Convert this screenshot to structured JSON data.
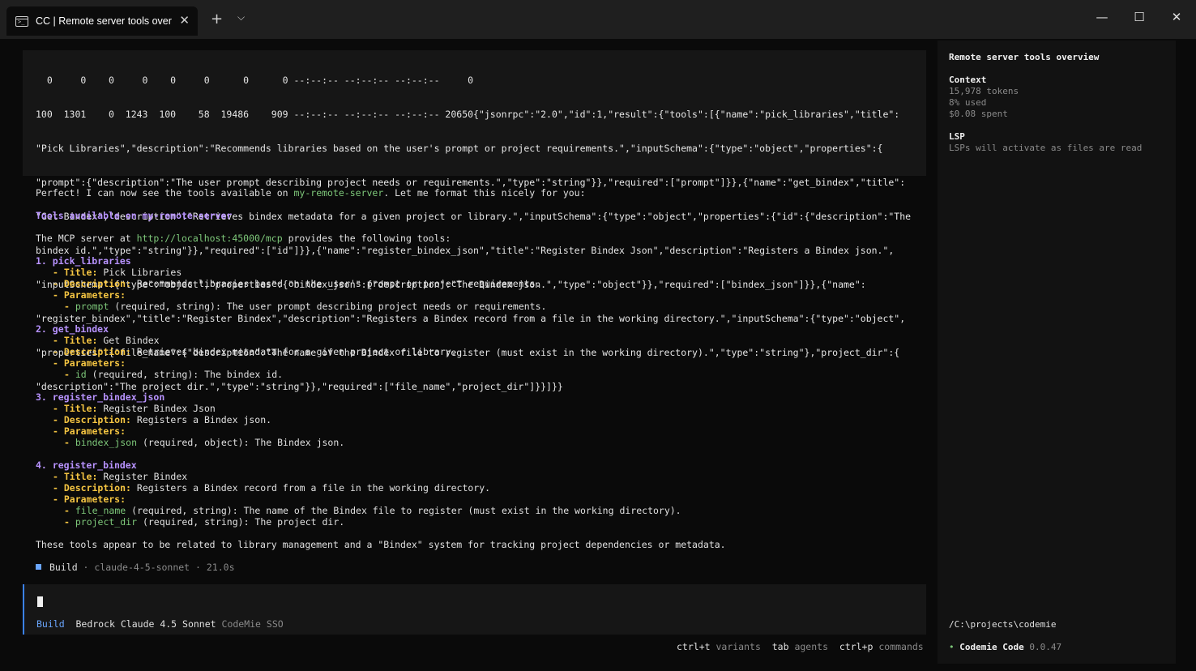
{
  "window": {
    "tab_title": "CC | Remote server tools over",
    "tab_icon": "terminal-icon",
    "controls": [
      "minimize-icon",
      "maximize-icon",
      "close-icon"
    ]
  },
  "tool_output": [
    "  0     0    0     0    0     0      0      0 --:--:-- --:--:-- --:--:--     0",
    "100  1301    0  1243  100    58  19486    909 --:--:-- --:--:-- --:--:-- 20650{\"jsonrpc\":\"2.0\",\"id\":1,\"result\":{\"tools\":[{\"name\":\"pick_libraries\",\"title\":",
    "\"Pick Libraries\",\"description\":\"Recommends libraries based on the user's prompt or project requirements.\",\"inputSchema\":{\"type\":\"object\",\"properties\":{",
    "\"prompt\":{\"description\":\"The user prompt describing project needs or requirements.\",\"type\":\"string\"}},\"required\":[\"prompt\"]}},{\"name\":\"get_bindex\",\"title\":",
    "\"Get Bindex\",\"description\":\"Retrieves bindex metadata for a given project or library.\",\"inputSchema\":{\"type\":\"object\",\"properties\":{\"id\":{\"description\":\"The",
    "bindex id.\",\"type\":\"string\"}},\"required\":[\"id\"]}},{\"name\":\"register_bindex_json\",\"title\":\"Register Bindex Json\",\"description\":\"Registers a Bindex json.\",",
    "\"inputSchema\":{\"type\":\"object\",\"properties\":{\"bindex_json\":{\"description\":\"The Bindex json.\",\"type\":\"object\"}},\"required\":[\"bindex_json\"]}},{\"name\":",
    "\"register_bindex\",\"title\":\"Register Bindex\",\"description\":\"Registers a Bindex record from a file in the working directory.\",\"inputSchema\":{\"type\":\"object\",",
    "\"properties\":{\"file_name\":{\"description\":\"The name of the Bindex file to register (must exist in the working directory).\",\"type\":\"string\"},\"project_dir\":{",
    "\"description\":\"The project dir.\",\"type\":\"string\"}},\"required\":[\"file_name\",\"project_dir\"]}}]}}"
  ],
  "message": {
    "intro_a": "Perfect! I can now see the tools available on ",
    "intro_server": "my-remote-server",
    "intro_b": ". Let me format this nicely for you:",
    "heading": "Tools available on my-remote-server",
    "server_a": "The MCP server at ",
    "server_url": "http://localhost:45000/mcp",
    "server_b": " provides the following tools:",
    "bullet": "- ",
    "title_label": "Title:",
    "desc_label": "Description:",
    "params_label": "Parameters:",
    "tools": [
      {
        "number": "1.",
        "name": "pick_libraries",
        "title": "Pick Libraries",
        "description": "Recommends libraries based on the user's prompt or project requirements.",
        "params": [
          {
            "name": "prompt",
            "detail": " (required, string): The user prompt describing project needs or requirements."
          }
        ]
      },
      {
        "number": "2.",
        "name": "get_bindex",
        "title": "Get Bindex",
        "description": "Retrieves bindex metadata for a given project or library.",
        "params": [
          {
            "name": "id",
            "detail": " (required, string): The bindex id."
          }
        ]
      },
      {
        "number": "3.",
        "name": "register_bindex_json",
        "title": "Register Bindex Json",
        "description": "Registers a Bindex json.",
        "params": [
          {
            "name": "bindex_json",
            "detail": " (required, object): The Bindex json."
          }
        ]
      },
      {
        "number": "4.",
        "name": "register_bindex",
        "title": "Register Bindex",
        "description": "Registers a Bindex record from a file in the working directory.",
        "params": [
          {
            "name": "file_name",
            "detail": " (required, string): The name of the Bindex file to register (must exist in the working directory)."
          },
          {
            "name": "project_dir",
            "detail": " (required, string): The project dir."
          }
        ]
      }
    ],
    "conclusion": "These tools appear to be related to library management and a \"Bindex\" system for tracking project dependencies or metadata."
  },
  "build_status": {
    "mode": "Build",
    "model": "claude-4-5-sonnet",
    "duration": "21.0s",
    "separator": " · "
  },
  "input": {
    "value": "",
    "mode": "Build",
    "model": "Bedrock Claude 4.5 Sonnet",
    "provider": "CodeMie SSO"
  },
  "hints": [
    {
      "key": "ctrl+t",
      "label": "variants"
    },
    {
      "key": "tab",
      "label": "agents"
    },
    {
      "key": "ctrl+p",
      "label": "commands"
    }
  ],
  "sidebar": {
    "title": "Remote server tools overview",
    "context_label": "Context",
    "tokens": "15,978 tokens",
    "used": "8% used",
    "spent": "$0.08 spent",
    "lsp_label": "LSP",
    "lsp_text": "LSPs will activate as files are read",
    "path": "/C:\\projects\\codemie",
    "app_dot": "•",
    "app_name": "Codemie Code",
    "version": "0.0.47"
  },
  "colors": {
    "accent_blue": "#3b82f6",
    "purple": "#b893ff",
    "yellow": "#f5c542",
    "green": "#7ec87a"
  }
}
